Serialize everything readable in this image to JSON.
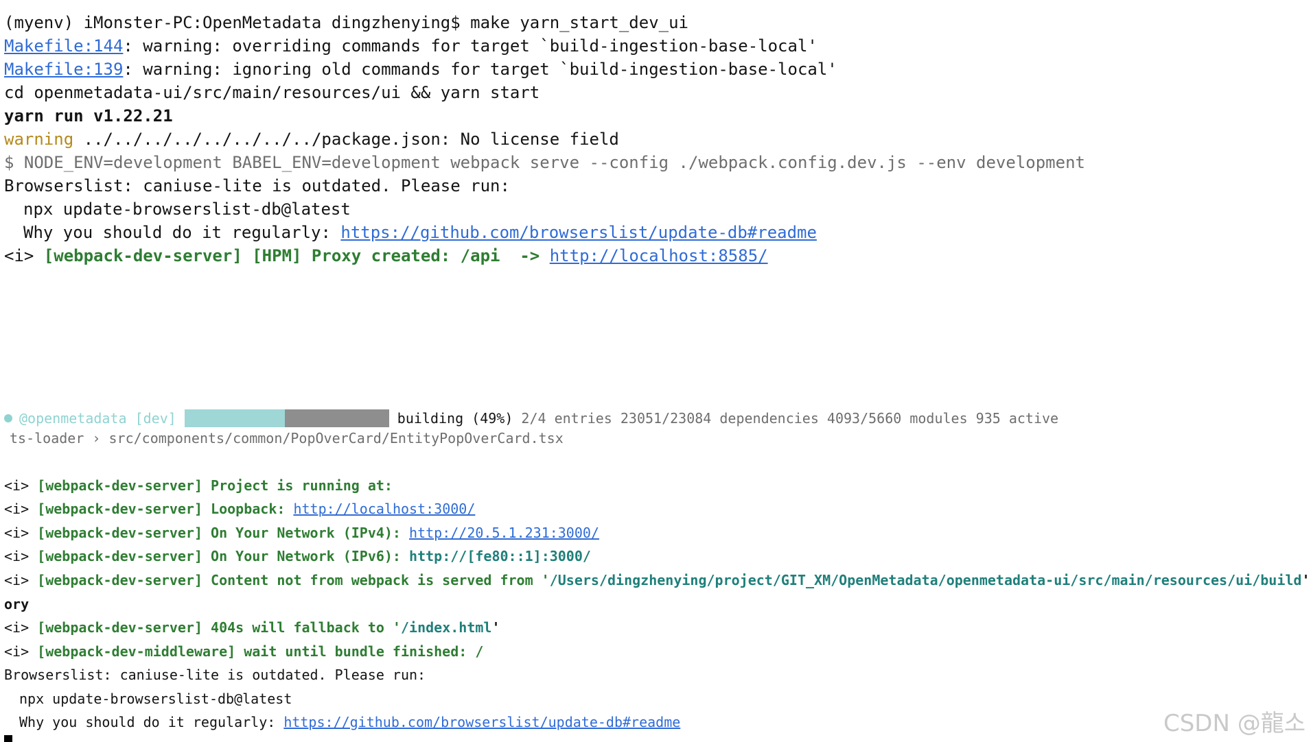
{
  "terminal": {
    "l1": "(myenv) iMonster-PC:OpenMetadata dingzhenying$ make yarn_start_dev_ui",
    "l2_link": "Makefile:144",
    "l2_text": ": warning: overriding commands for target `build-ingestion-base-local'",
    "l3_link": "Makefile:139",
    "l3_text": ": warning: ignoring old commands for target `build-ingestion-base-local'",
    "l4": "cd openmetadata-ui/src/main/resources/ui && yarn start",
    "l5": "yarn run v1.22.21",
    "l6_warn": "warning",
    "l6_text": " ../../../../../../../../package.json: No license field",
    "l7": "$ NODE_ENV=development BABEL_ENV=development webpack serve --config ./webpack.config.dev.js --env development",
    "l8": "Browserslist: caniuse-lite is outdated. Please run:",
    "l9": "npx update-browserslist-db@latest",
    "l10_text": "Why you should do it regularly: ",
    "l10_link": "https://github.com/browserslist/update-db#readme",
    "l11_prefix": "<i> ",
    "l11_green": "[webpack-dev-server] [HPM] Proxy created: /api  -> ",
    "l11_link": "http://localhost:8585/",
    "progress": {
      "project": "@openmetadata [dev]",
      "fraction": 0.49,
      "status": "building (49%)",
      "details": " 2/4 entries 23051/23084 dependencies 4093/5660 modules 935 active"
    },
    "loader": "ts-loader › src/components/common/PopOverCard/EntityPopOverCard.tsx",
    "s1_prefix": "<i> ",
    "s1_green": "[webpack-dev-server] Project is running at:",
    "s2_prefix": "<i> ",
    "s2_green": "[webpack-dev-server] Loopback: ",
    "s2_link": "http://localhost:3000/",
    "s3_prefix": "<i> ",
    "s3_green": "[webpack-dev-server] On Your Network (IPv4): ",
    "s3_link": "http://20.5.1.231:3000/",
    "s4_prefix": "<i> ",
    "s4_green": "[webpack-dev-server] On Your Network (IPv6): ",
    "s4_link": "http://[fe80::1]:3000/",
    "s5_prefix": "<i> ",
    "s5_green": "[webpack-dev-server] Content not from webpack is served from '",
    "s5_teal": "/Users/dingzhenying/project/GIT_XM/OpenMetadata/openmetadata-ui/src/main/resources/ui/build",
    "s5_end": "' di",
    "s6": "ory",
    "s7_prefix": "<i> ",
    "s7_green": "[webpack-dev-server] 404s will fallback to '",
    "s7_teal": "/index.html",
    "s7_end": "'",
    "s8_prefix": "<i> ",
    "s8_green": "[webpack-dev-middleware] wait until bundle finished: /",
    "s9": "Browserslist: caniuse-lite is outdated. Please run:",
    "s10": "npx update-browserslist-db@latest",
    "s11_text": "Why you should do it regularly: ",
    "s11_link": "https://github.com/browserslist/update-db#readme"
  },
  "watermark": "CSDN @龍소"
}
